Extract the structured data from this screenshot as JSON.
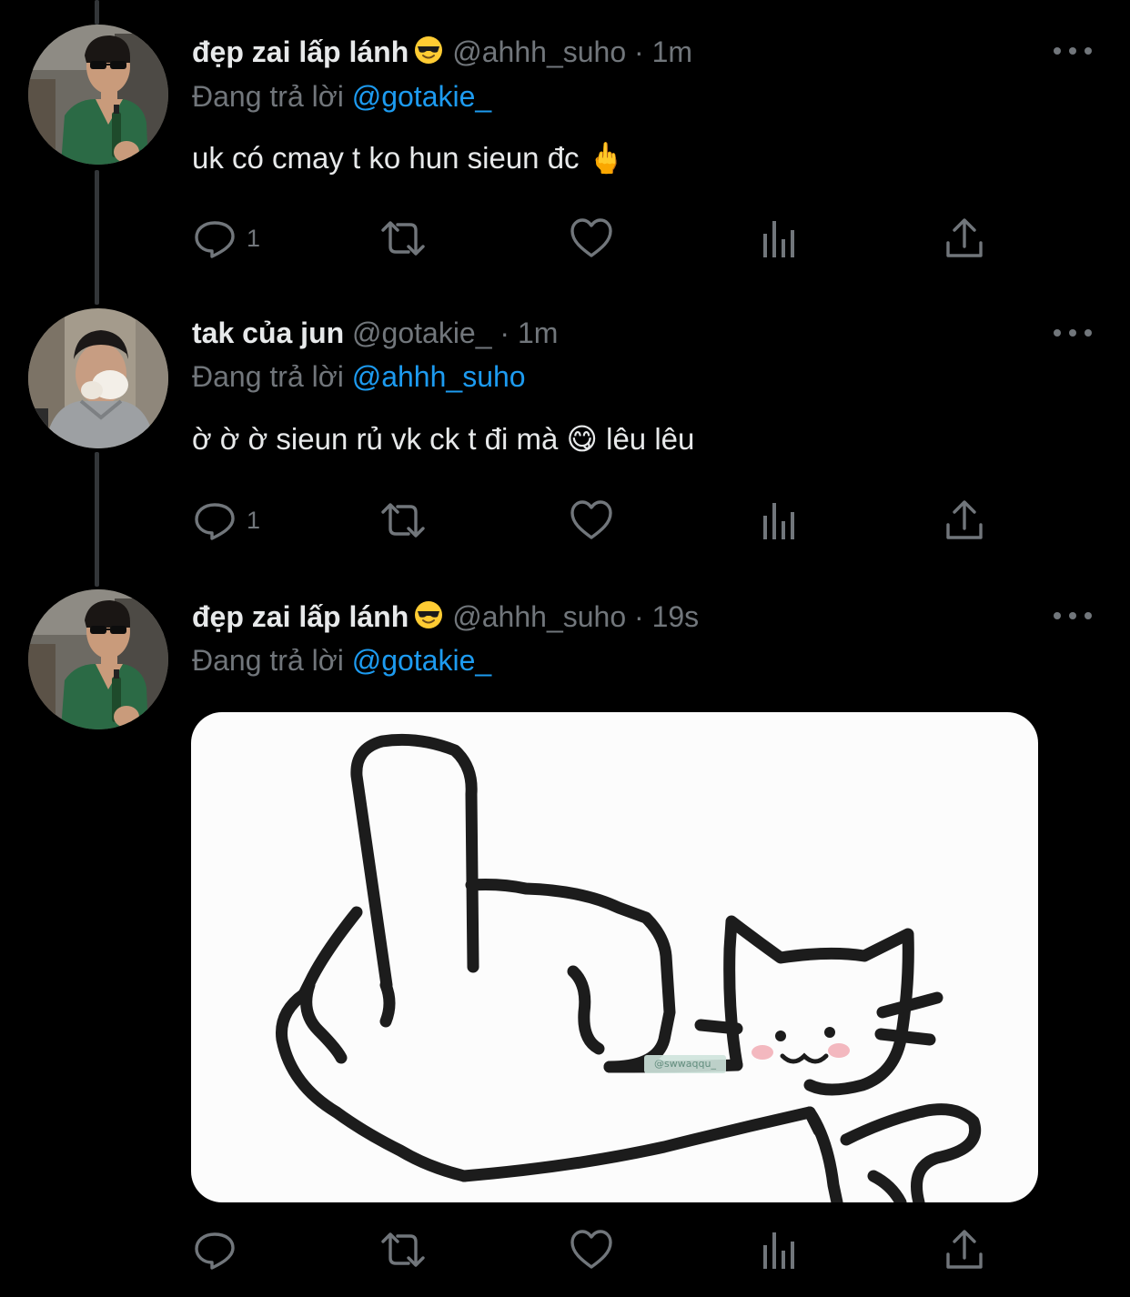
{
  "tweets": [
    {
      "display_name": "đẹp zai lấp lánh",
      "name_emoji": "smiling-face-with-sunglasses-emoji",
      "handle": "@ahhh_suho",
      "separator": "·",
      "time": "1m",
      "reply_prefix": "Đang trả lời",
      "reply_to": "@gotakie_",
      "text": "uk có cmay t ko hun sieun đc 🖕",
      "reply_count": "1",
      "avatar": "avatar-suho"
    },
    {
      "display_name": "tak của jun",
      "handle": "@gotakie_",
      "separator": "·",
      "time": "1m",
      "reply_prefix": "Đang trả lời",
      "reply_to": "@ahhh_suho",
      "text_before_emoji": "ờ ờ ờ sieun rủ vk ck t đi mà",
      "text_emoji": "😋",
      "text_after_emoji": "lêu lêu",
      "reply_count": "1",
      "avatar": "avatar-gotakie"
    },
    {
      "display_name": "đẹp zai lấp lánh",
      "name_emoji": "smiling-face-with-sunglasses-emoji",
      "handle": "@ahhh_suho",
      "separator": "·",
      "time": "19s",
      "reply_prefix": "Đang trả lời",
      "reply_to": "@gotakie_",
      "media": {
        "description_icon": "cat-middle-finger-drawing",
        "watermark": "@swwaqqu_"
      },
      "reply_count": "",
      "avatar": "avatar-suho"
    }
  ],
  "icons": {
    "reply": "reply-icon",
    "retweet": "retweet-icon",
    "like": "like-icon",
    "views": "views-icon",
    "share": "share-icon",
    "more": "more-icon"
  },
  "colors": {
    "background": "#000000",
    "text_primary": "#e7e9ea",
    "text_secondary": "#71767b",
    "mention_blue": "#1d9bf0",
    "thread_line": "#333639"
  }
}
